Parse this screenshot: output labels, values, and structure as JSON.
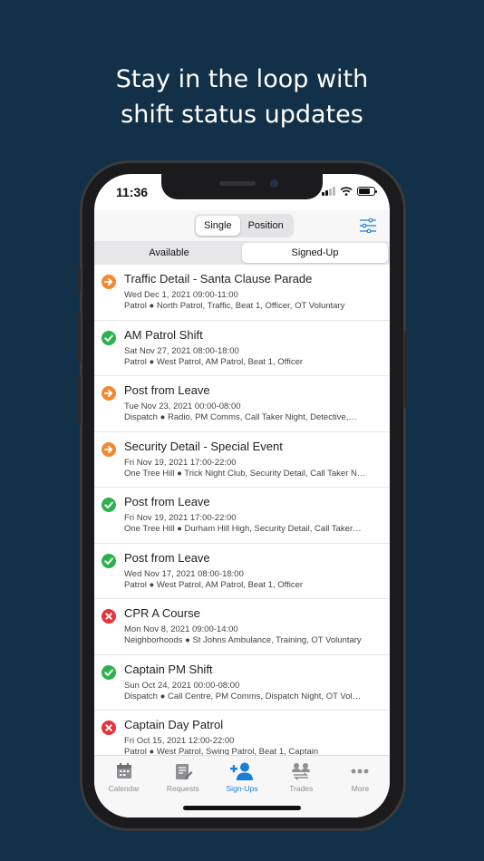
{
  "headline": {
    "line1": "Stay in the loop with",
    "line2": "shift status updates"
  },
  "status_bar": {
    "time": "11:36"
  },
  "mode_toggle": {
    "options": [
      "Single",
      "Position"
    ],
    "selected": "Single"
  },
  "tabs": {
    "items": [
      "Available",
      "Signed-Up"
    ],
    "selected": "Signed-Up"
  },
  "colors": {
    "background": "#123048",
    "pending": "#f7882f",
    "approved": "#2bb24c",
    "denied": "#e8323b",
    "accent": "#1a7fd6"
  },
  "shifts": [
    {
      "status": "pending",
      "icon": "arrow-right-circle-icon",
      "title": "Traffic Detail - Santa Clause Parade",
      "date": "Wed Dec 1, 2021 09:00-11:00",
      "details": "Patrol ● North Patrol, Traffic, Beat 1, Officer, OT Voluntary"
    },
    {
      "status": "approved",
      "icon": "check-circle-icon",
      "title": "AM Patrol Shift",
      "date": "Sat Nov 27, 2021 08:00-18:00",
      "details": "Patrol ● West Patrol, AM Patrol, Beat 1, Officer"
    },
    {
      "status": "pending",
      "icon": "arrow-right-circle-icon",
      "title": "Post from Leave",
      "date": "Tue Nov 23, 2021 00:00-08:00",
      "details": "Dispatch ● Radio, PM Comms, Call Taker Night, Detective,…"
    },
    {
      "status": "pending",
      "icon": "arrow-right-circle-icon",
      "title": "Security Detail - Special Event",
      "date": "Fri Nov 19, 2021 17:00-22:00",
      "details": "One Tree Hill ● Trick Night Club, Security Detail, Call Taker N…"
    },
    {
      "status": "approved",
      "icon": "check-circle-icon",
      "title": "Post from Leave",
      "date": "Fri Nov 19, 2021 17:00-22:00",
      "details": "One Tree Hill ● Durham Hill High, Security Detail, Call Taker…"
    },
    {
      "status": "approved",
      "icon": "check-circle-icon",
      "title": "Post from Leave",
      "date": "Wed Nov 17, 2021 08:00-18:00",
      "details": "Patrol ● West Patrol, AM Patrol, Beat 1, Officer"
    },
    {
      "status": "denied",
      "icon": "x-circle-icon",
      "title": "CPR A Course",
      "date": "Mon Nov 8, 2021 09:00-14:00",
      "details": "Neighborhoods ● St Johns Ambulance, Training, OT Voluntary"
    },
    {
      "status": "approved",
      "icon": "check-circle-icon",
      "title": "Captain PM Shift",
      "date": "Sun Oct 24, 2021 00:00-08:00",
      "details": "Dispatch ● Call Centre, PM Comms, Dispatch Night, OT Vol…"
    },
    {
      "status": "denied",
      "icon": "x-circle-icon",
      "title": "Captain Day Patrol",
      "date": "Fri Oct 15, 2021 12:00-22:00",
      "details": "Patrol ● West Patrol, Swing Patrol, Beat 1, Captain"
    }
  ],
  "tab_bar": {
    "items": [
      {
        "label": "Calendar",
        "icon": "calendar-icon"
      },
      {
        "label": "Requests",
        "icon": "requests-icon"
      },
      {
        "label": "Sign-Ups",
        "icon": "add-user-icon"
      },
      {
        "label": "Trades",
        "icon": "trades-icon"
      },
      {
        "label": "More",
        "icon": "more-icon"
      }
    ],
    "selected": "Sign-Ups"
  }
}
